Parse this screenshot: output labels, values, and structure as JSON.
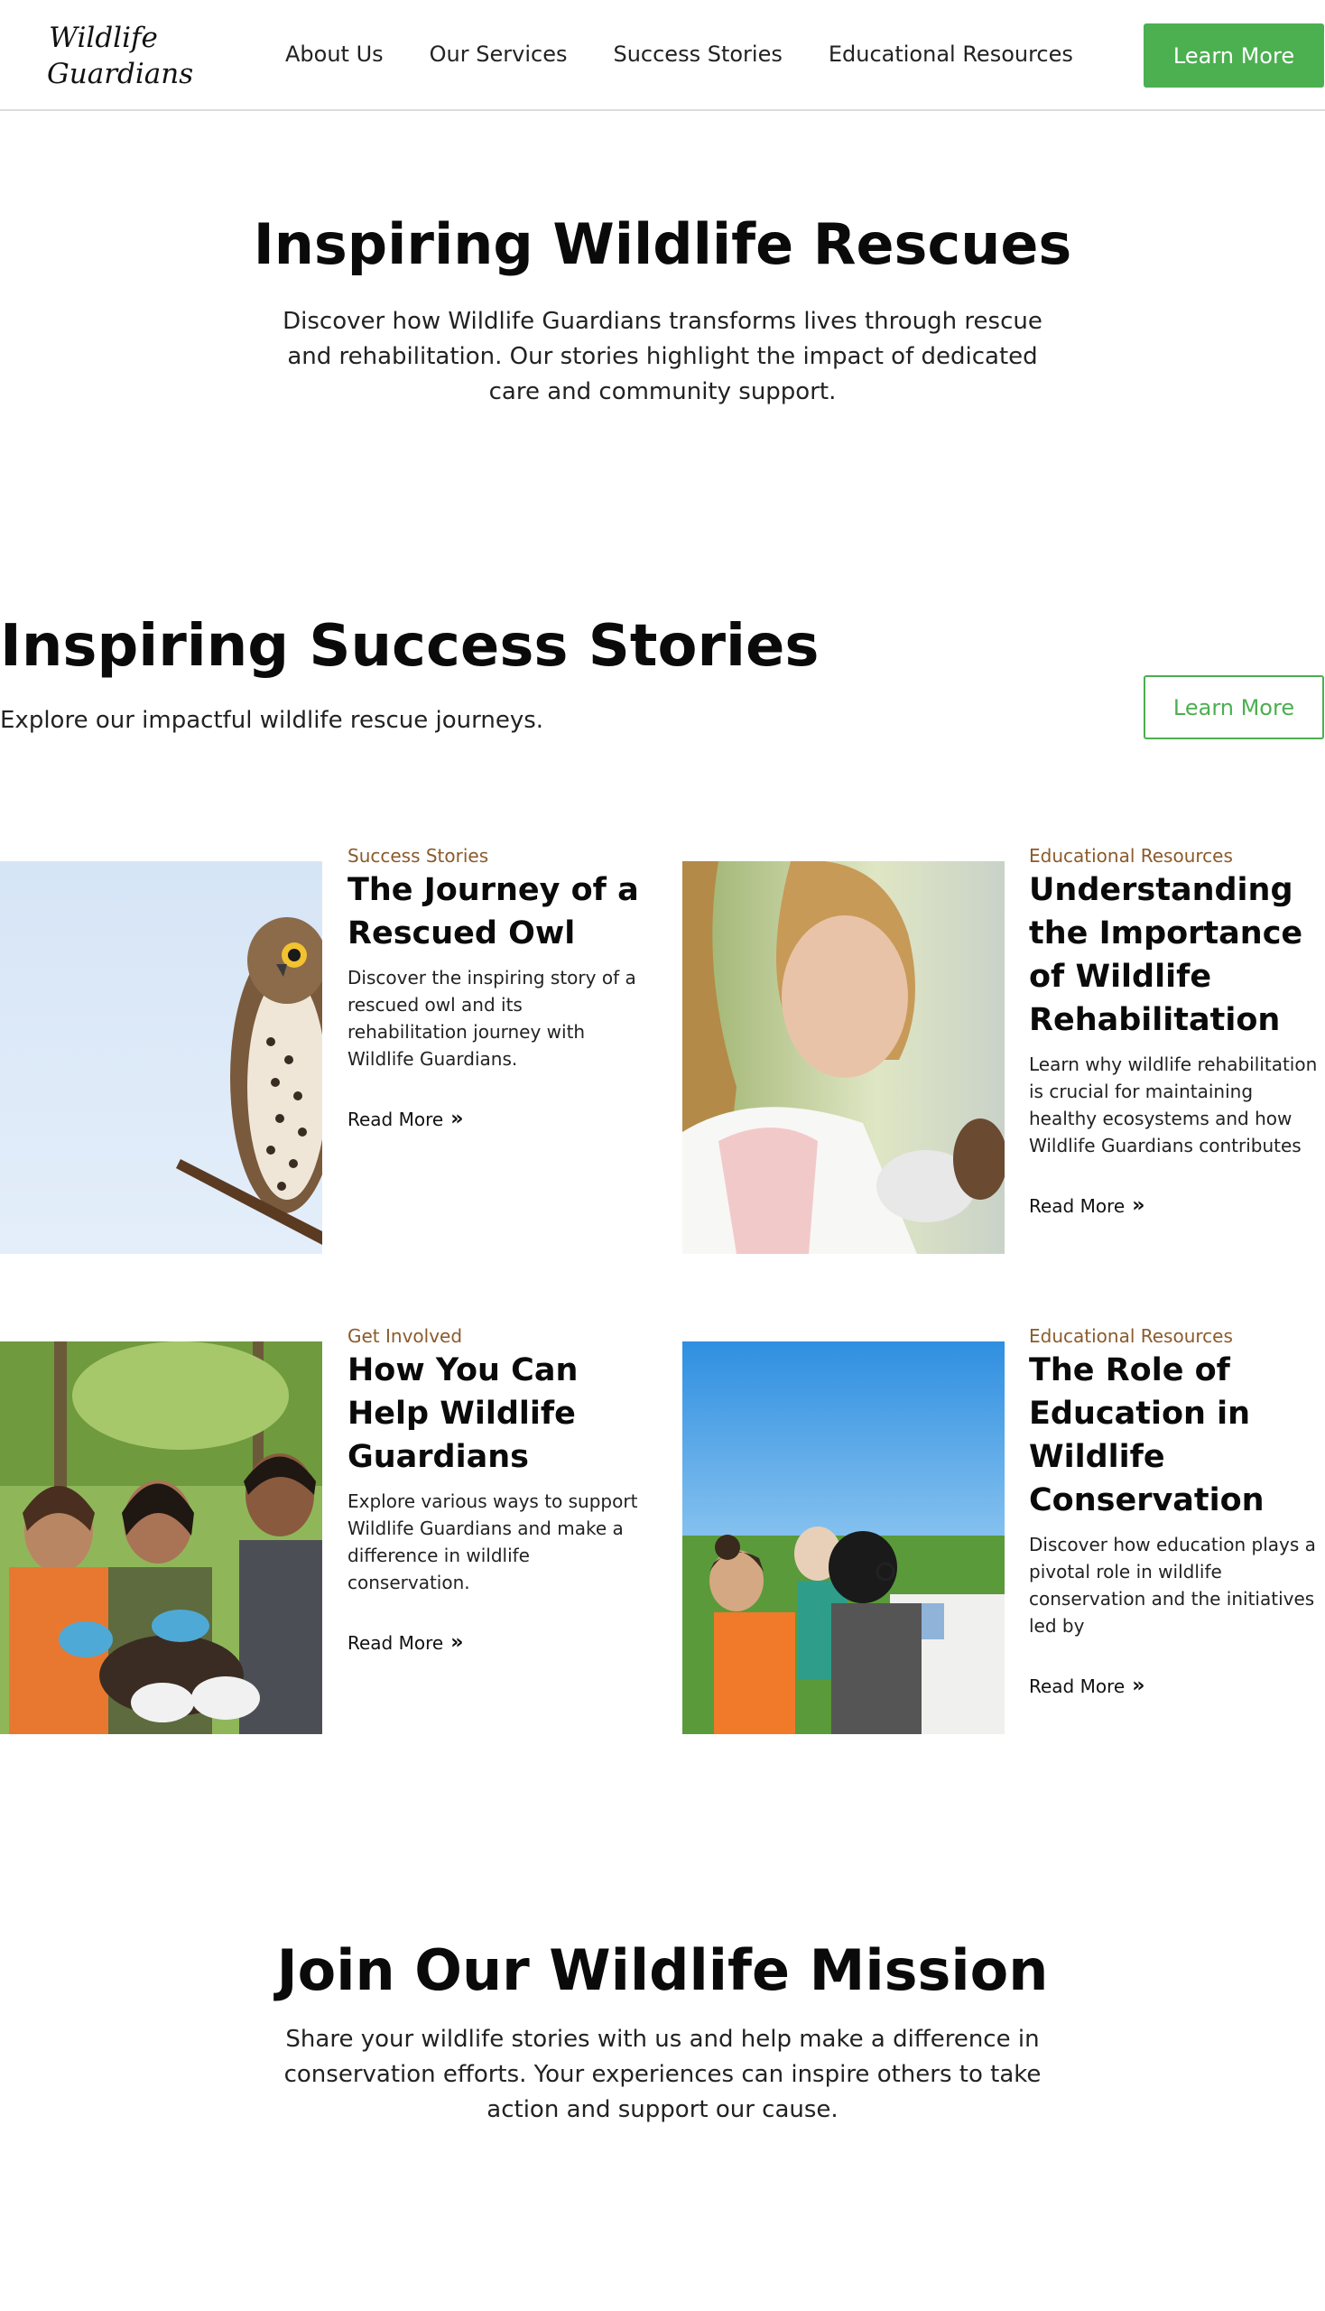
{
  "header": {
    "logo_line1": "Wildlife",
    "logo_line2": "Guardians",
    "nav": [
      "About Us",
      "Our Services",
      "Success Stories",
      "Educational Resources"
    ],
    "cta_label": "Learn More"
  },
  "hero": {
    "title": "Inspiring Wildlife Rescues",
    "text": "Discover how Wildlife Guardians transforms lives through rescue and rehabilitation. Our stories highlight the impact of dedicated care and community support."
  },
  "stories": {
    "title": "Inspiring Success Stories",
    "subtitle": "Explore our impactful wildlife rescue journeys.",
    "cta_label": "Learn More",
    "read_more_label": "Read More",
    "read_more_icon": "double-chevron-right-icon",
    "cards": [
      {
        "category": "Success Stories",
        "title": "The Journey of a Rescued Owl",
        "description": "Discover the inspiring story of a rescued owl and its rehabilitation journey with Wildlife Guardians."
      },
      {
        "category": "Educational Resources",
        "title": "Understanding the Importance of Wildlife Rehabilitation",
        "description": "Learn why wildlife rehabilitation is crucial for maintaining healthy ecosystems and how Wildlife Guardians contributes"
      },
      {
        "category": "Get Involved",
        "title": "How You Can Help Wildlife Guardians",
        "description": "Explore various ways to support Wildlife Guardians and make a difference in wildlife conservation."
      },
      {
        "category": "Educational Resources",
        "title": "The Role of Education in Wildlife Conservation",
        "description": "Discover how education plays a pivotal role in wildlife conservation and the initiatives led by"
      }
    ]
  },
  "join": {
    "title": "Join Our Wildlife Mission",
    "text": "Share your wildlife stories with us and help make a difference in conservation efforts. Your experiences can inspire others to take action and support our cause."
  },
  "colors": {
    "accent": "#4caf50",
    "category": "#8b5a2b",
    "text": "#111111"
  }
}
